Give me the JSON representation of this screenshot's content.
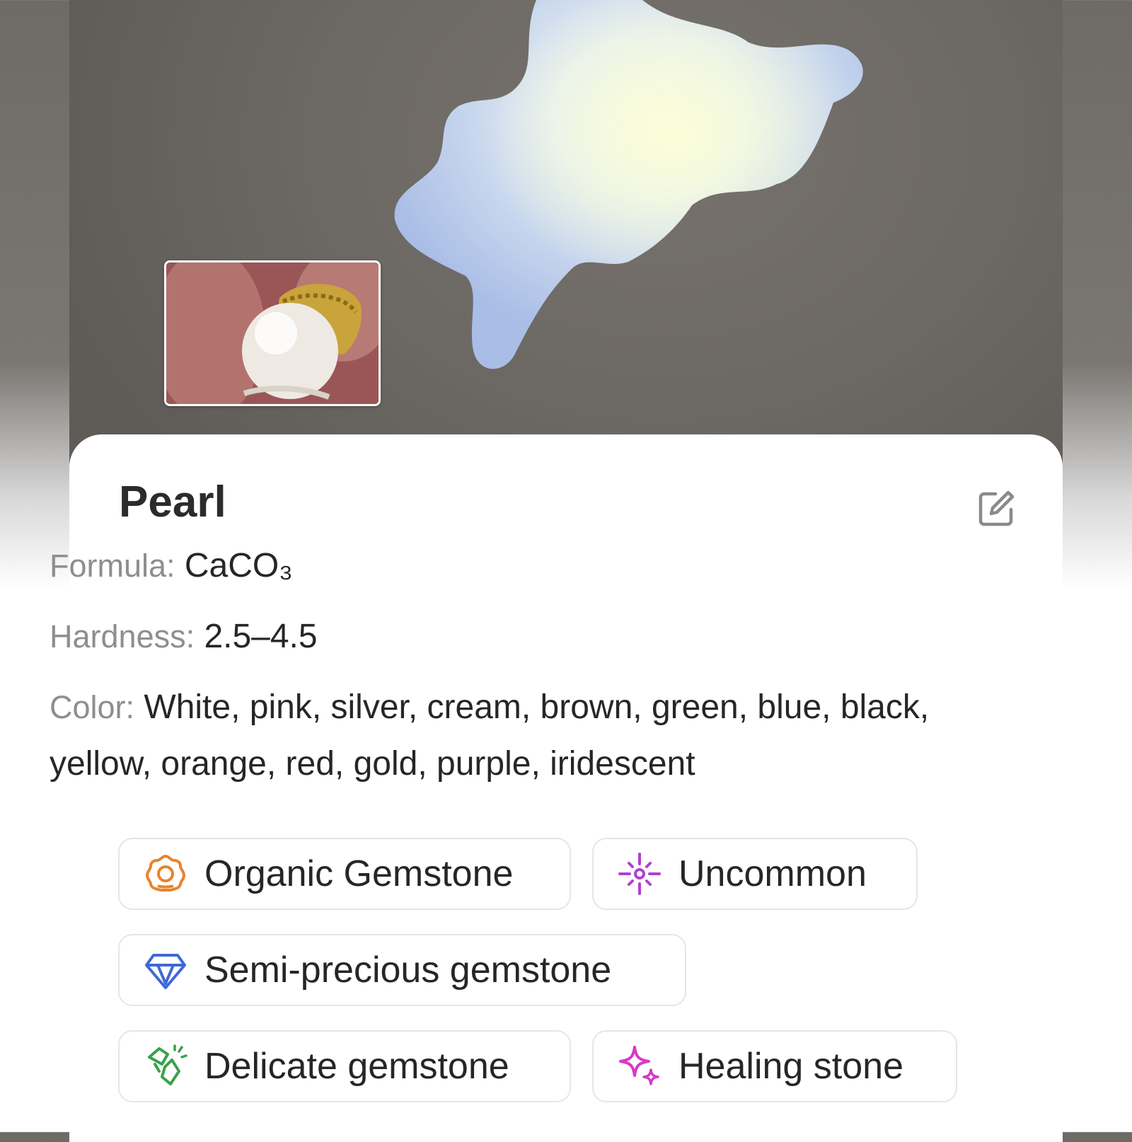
{
  "gemstone": {
    "name": "Pearl",
    "properties": [
      {
        "key": "Formula:",
        "value": "CaCO₃"
      },
      {
        "key": "Hardness:",
        "value": "2.5–4.5"
      },
      {
        "key": "Color:",
        "value": "White, pink, silver, cream, brown, green, blue, black, yellow, orange, red, gold, purple, iridescent"
      }
    ]
  },
  "tags": [
    {
      "label": "Organic Gemstone",
      "icon": "organic-gemstone-icon",
      "color": "#e8842a"
    },
    {
      "label": "Uncommon",
      "icon": "sparkle-rarity-icon",
      "color": "#b23fd1"
    },
    {
      "label": "Semi-precious gemstone",
      "icon": "diamond-icon",
      "color": "#3f67d9"
    },
    {
      "label": "Delicate gemstone",
      "icon": "broken-crystal-icon",
      "color": "#3aa14a"
    },
    {
      "label": "Healing stone",
      "icon": "healing-sparkle-icon",
      "color": "#d63ac8"
    }
  ],
  "colors": {
    "title": "#2b2b2b",
    "label": "#8e8e8e",
    "value": "#262626",
    "chip_border": "#e6e6e6"
  }
}
